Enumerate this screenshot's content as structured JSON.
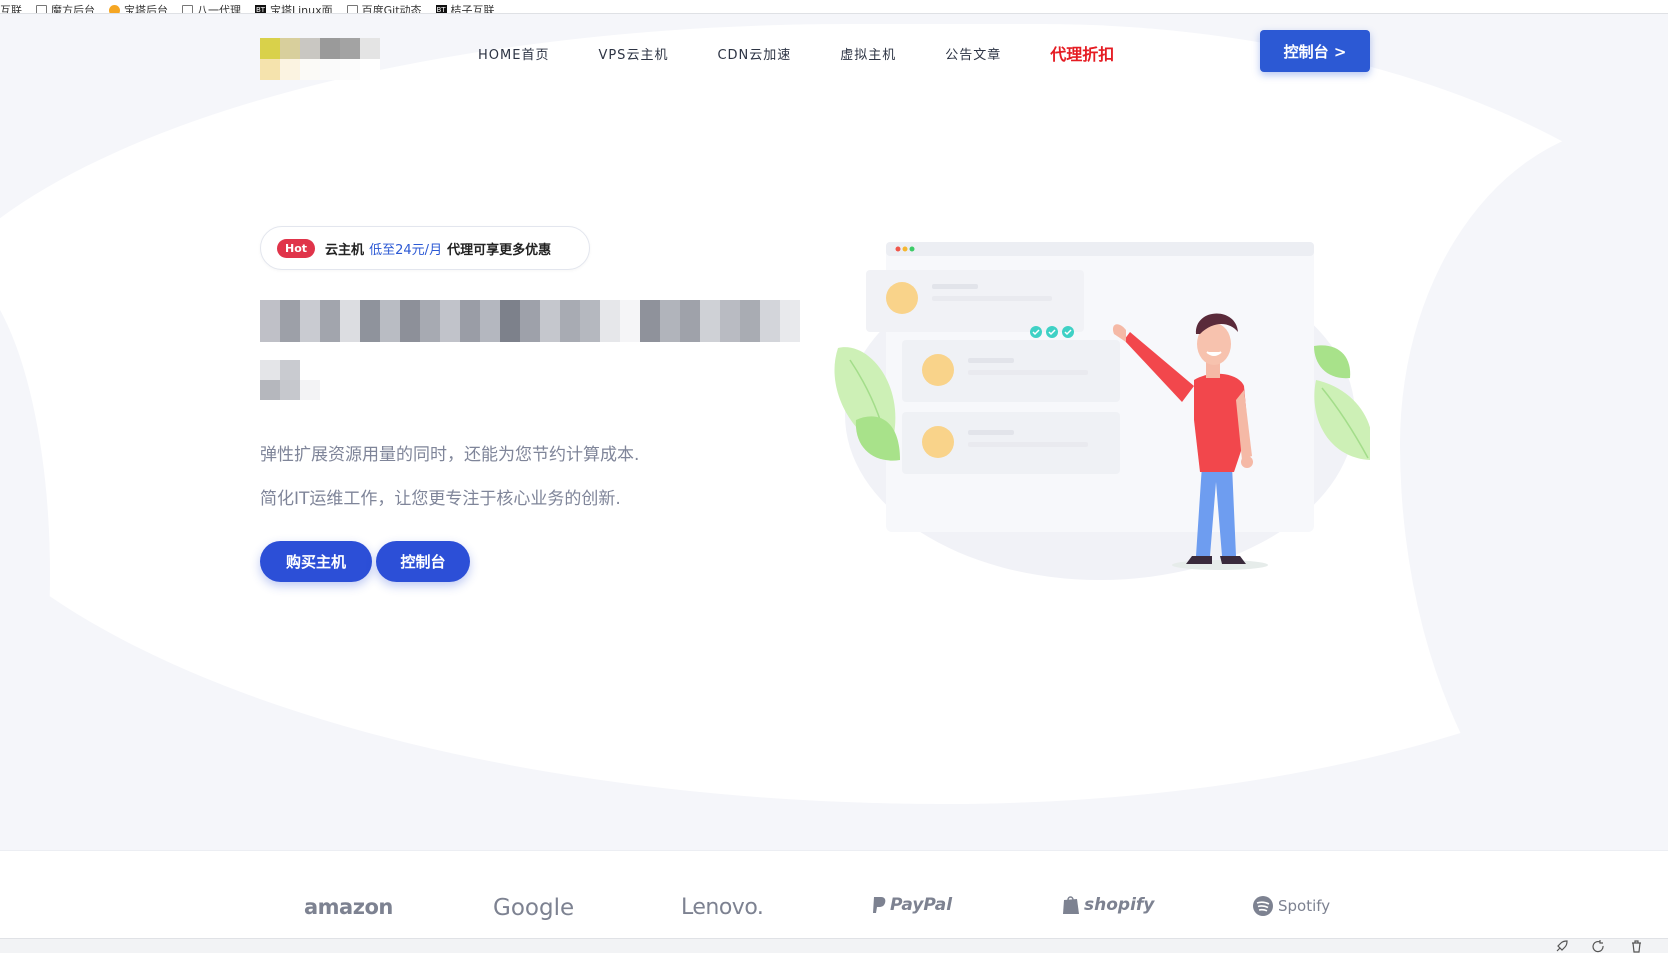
{
  "bookmarks": [
    {
      "label": "互联",
      "icon": "page-icon"
    },
    {
      "label": "魔方后台",
      "icon": "page-icon"
    },
    {
      "label": "宝塔后台",
      "icon": "orange-icon"
    },
    {
      "label": "八一代理",
      "icon": "page-icon"
    },
    {
      "label": "宝塔Linux面",
      "icon": "bt-icon"
    },
    {
      "label": "百度Git动态",
      "icon": "page-icon"
    },
    {
      "label": "桔子互联",
      "icon": "bt-icon"
    }
  ],
  "nav": {
    "items": [
      "HOME首页",
      "VPS云主机",
      "CDN云加速",
      "虚拟主机",
      "公告文章"
    ],
    "promo": "代理折扣",
    "console_button": "控制台 >"
  },
  "hero": {
    "hot_badge": "Hot",
    "hot_text_1": "云主机",
    "hot_accent": "低至24元/月",
    "hot_text_2": "代理可享更多优惠",
    "lede_1": "弹性扩展资源用量的同时，还能为您节约计算成本.",
    "lede_2": "简化IT运维工作，让您更专注于核心业务的创新.",
    "buy_button": "购买主机",
    "console_button": "控制台"
  },
  "brands": [
    "amazon",
    "Google",
    "Lenovo.",
    "PayPal",
    "shopify",
    "Spotify"
  ],
  "colors": {
    "primary": "#2c59d4",
    "promo": "#e51c23",
    "hot": "#e0344a",
    "text": "#232a3d",
    "muted": "#7f8599"
  }
}
